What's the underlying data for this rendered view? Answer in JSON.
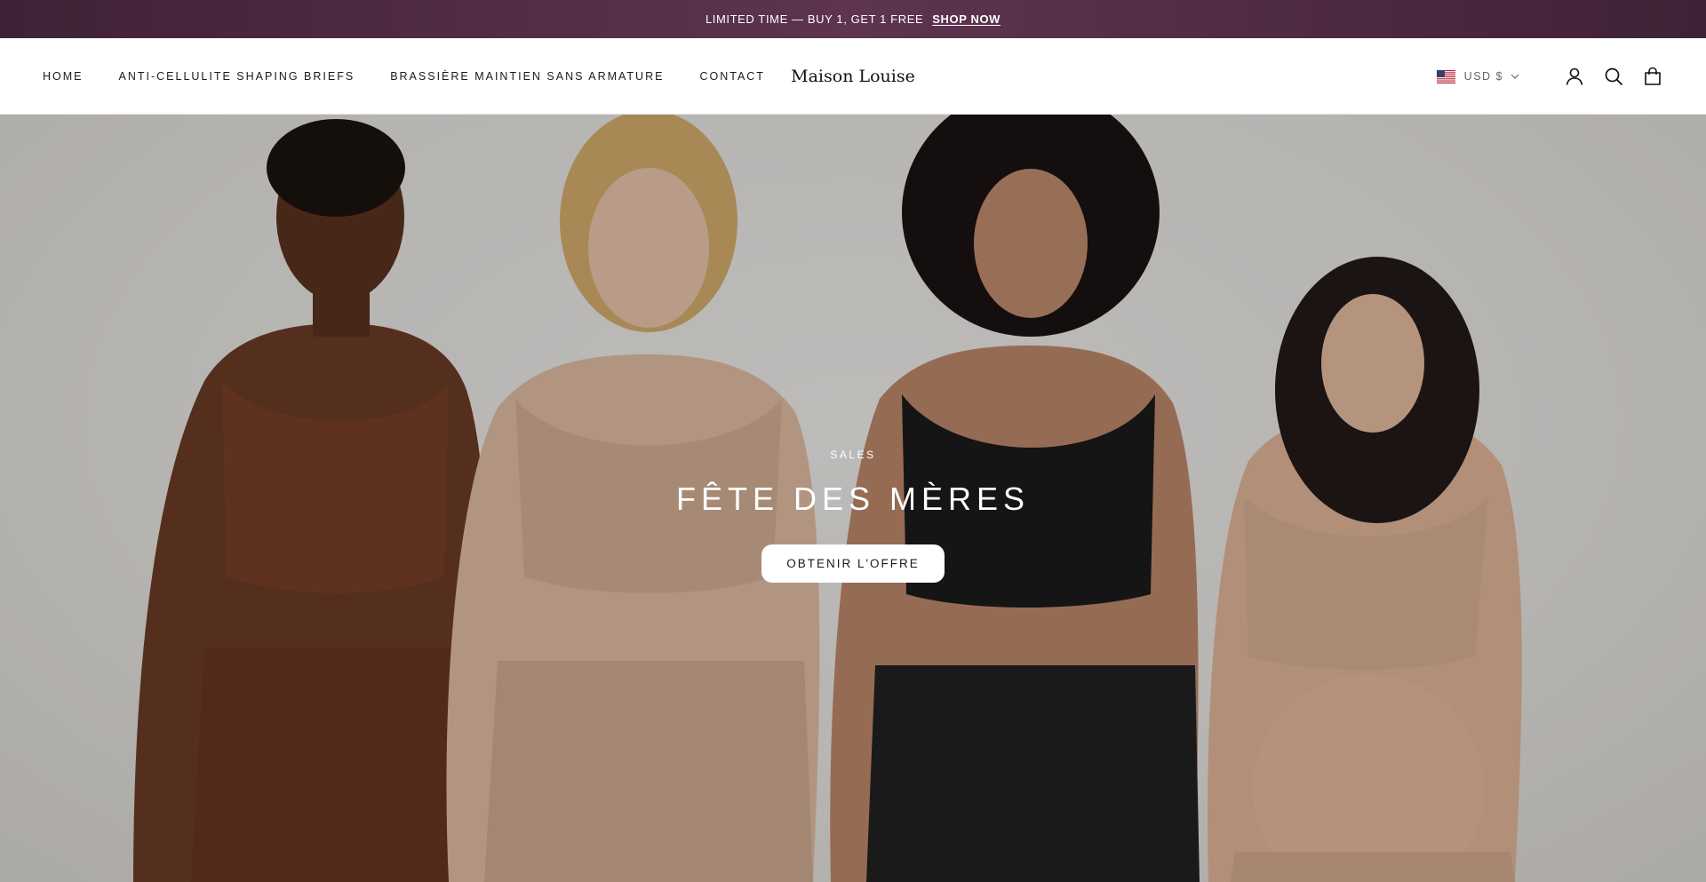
{
  "announcement": {
    "text": "LIMITED TIME — BUY 1, GET 1 FREE",
    "link_label": "SHOP NOW"
  },
  "header": {
    "nav": [
      {
        "label": "HOME"
      },
      {
        "label": "ANTI-CELLULITE SHAPING BRIEFS"
      },
      {
        "label": "BRASSIÈRE MAINTIEN SANS ARMATURE"
      },
      {
        "label": "CONTACT"
      }
    ],
    "logo": "Maison Louise",
    "currency": {
      "label": "USD $",
      "flag_icon": "us-flag-icon"
    },
    "icons": [
      "account-icon",
      "search-icon",
      "cart-icon"
    ]
  },
  "hero": {
    "eyebrow": "SALES",
    "title": "FÊTE DES MÈRES",
    "cta_label": "OBTENIR L'OFFRE"
  },
  "colors": {
    "announcement_bg": "#4f2b45",
    "text_dark": "#1a1a1a",
    "hero_text": "#ffffff"
  }
}
